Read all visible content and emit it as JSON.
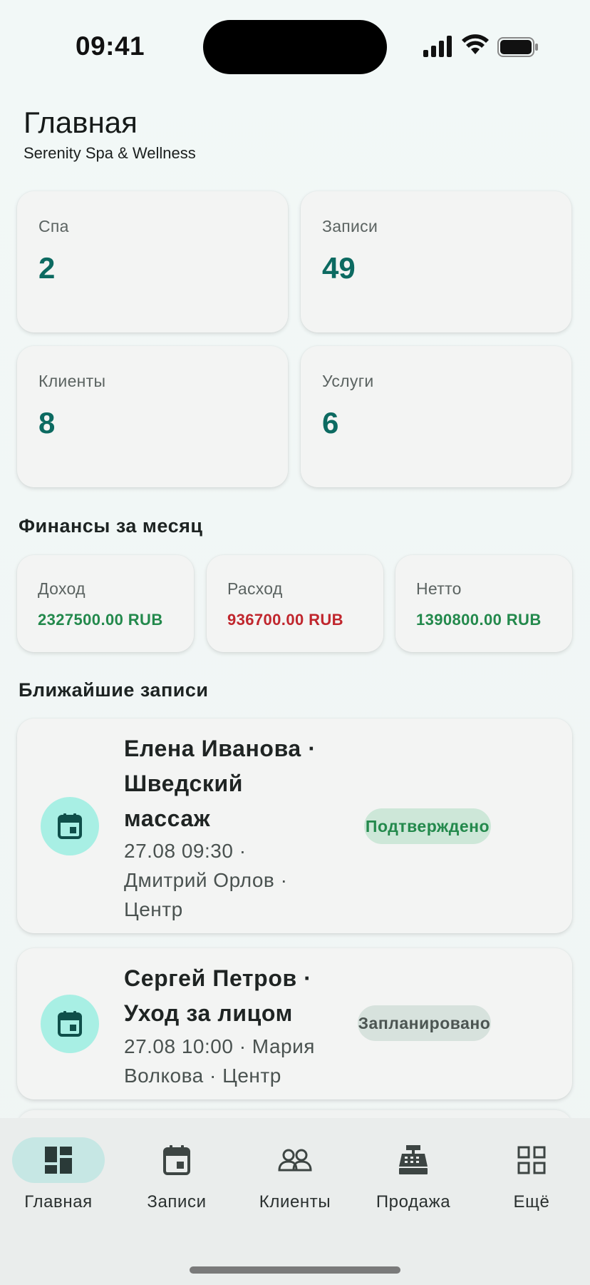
{
  "status_bar": {
    "time": "09:41"
  },
  "header": {
    "title": "Главная",
    "subtitle": "Serenity Spa & Wellness"
  },
  "stats": [
    {
      "label": "Спа",
      "value": "2"
    },
    {
      "label": "Записи",
      "value": "49"
    },
    {
      "label": "Клиенты",
      "value": "8"
    },
    {
      "label": "Услуги",
      "value": "6"
    }
  ],
  "finance": {
    "title": "Финансы за месяц",
    "cards": [
      {
        "label": "Доход",
        "value": "2327500.00 RUB",
        "color": "#23894c"
      },
      {
        "label": "Расход",
        "value": "936700.00 RUB",
        "color": "#c0262d"
      },
      {
        "label": "Нетто",
        "value": "1390800.00 RUB",
        "color": "#23894c"
      }
    ]
  },
  "appointments": {
    "title": "Ближайшие записи",
    "items": [
      {
        "title_lines": [
          "Елена Иванова ·",
          "Шведский",
          "массаж"
        ],
        "meta_lines": [
          "27.08 09:30 ·",
          "Дмитрий Орлов ·",
          "Центр"
        ],
        "status": "Подтверждено",
        "icon": "calendar-icon"
      },
      {
        "title_lines": [
          "Сергей Петров ·",
          "Уход за лицом"
        ],
        "meta_lines": [
          "27.08 10:00 · Мария",
          "Волкова · Центр"
        ],
        "status": "Запланировано",
        "icon": "calendar-icon"
      }
    ]
  },
  "nav": {
    "items": [
      {
        "label": "Главная",
        "icon": "dashboard-icon",
        "active": true
      },
      {
        "label": "Записи",
        "icon": "calendar-icon"
      },
      {
        "label": "Клиенты",
        "icon": "people-icon"
      },
      {
        "label": "Продажа",
        "icon": "cash-register-icon"
      },
      {
        "label": "Ещё",
        "icon": "grid-icon"
      }
    ]
  },
  "colors": {
    "accent": "#0c6a61",
    "income": "#23894c",
    "expense": "#c0262d",
    "icon_bg": "#a8efe4"
  }
}
